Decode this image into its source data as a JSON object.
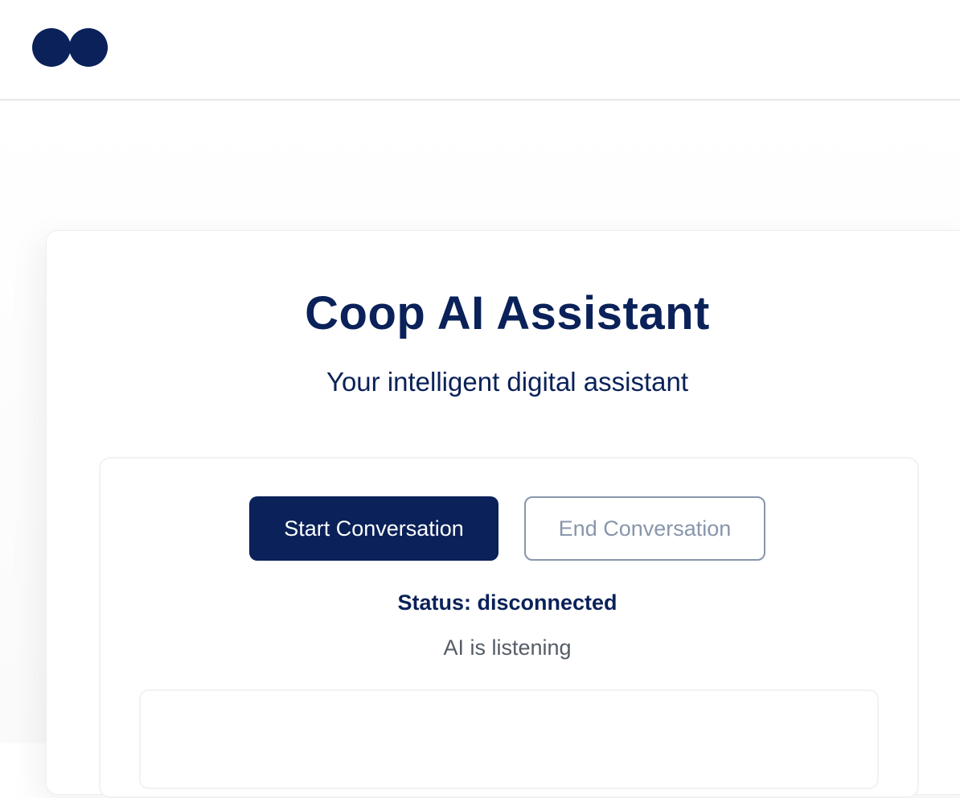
{
  "colors": {
    "brand": "#0a2159",
    "muted_text": "#555c66",
    "disabled_border": "#8896ab"
  },
  "header": {
    "logo_icon": "two-dots-logo"
  },
  "main": {
    "title": "Coop AI Assistant",
    "subtitle": "Your intelligent digital assistant",
    "controls": {
      "start_label": "Start Conversation",
      "end_label": "End Conversation",
      "status_prefix": "Status:",
      "status_value": "disconnected",
      "listening_text": "AI is listening"
    }
  }
}
